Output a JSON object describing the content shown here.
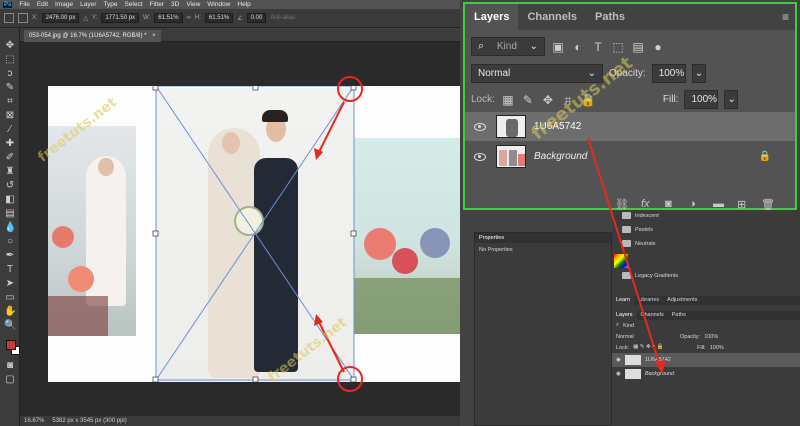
{
  "menubar": {
    "app_badge": "Ps",
    "items": [
      "File",
      "Edit",
      "Image",
      "Layer",
      "Type",
      "Select",
      "Filter",
      "3D",
      "View",
      "Window",
      "Help"
    ]
  },
  "options": {
    "x_label": "X:",
    "x_value": "2476.00 px",
    "y_label": "Y:",
    "y_value": "1771.50 px",
    "w_label": "W:",
    "w_value": "61.51%",
    "h_label": "H:",
    "h_value": "61.51%",
    "angle_value": "0.00",
    "antialias_label": "Anti-alias"
  },
  "document": {
    "tab_title": "053-054.jpg @ 16.7% (1U6A5742, RGB/8) *",
    "zoom": "16.67%",
    "dimensions": "5382 px x 3545 px (300 ppi)"
  },
  "colors": {
    "foreground": "#c83a3a",
    "background": "#ffffff",
    "highlight_green": "#3fcc3f",
    "annotation_red": "#e8281e"
  },
  "layers_panel": {
    "tabs": [
      "Layers",
      "Channels",
      "Paths"
    ],
    "active_tab": "Layers",
    "kind_label": "Kind",
    "blend_mode": "Normal",
    "opacity_label": "Opacity:",
    "opacity_value": "100%",
    "lock_label": "Lock:",
    "fill_label": "Fill:",
    "fill_value": "100%",
    "layers": [
      {
        "name": "1U6A5742",
        "selected": true
      },
      {
        "name": "Background",
        "selected": false,
        "locked": true
      }
    ]
  },
  "gradients": {
    "items": [
      "Iridescent",
      "Pastels",
      "Neutrals"
    ],
    "legacy": "Legacy Gradients"
  },
  "properties": {
    "title": "Properties",
    "content": "No Properties"
  },
  "mini_panel": {
    "tabs": [
      "Learn",
      "Libraries",
      "Adjustments"
    ],
    "layer_tabs": [
      "Layers",
      "Channels",
      "Paths"
    ],
    "kind_label": "Kind",
    "blend_mode": "Normal",
    "opacity_label": "Opacity:",
    "opacity_value": "100%",
    "lock_label": "Lock:",
    "fill_label": "Fill:",
    "fill_value": "100%",
    "layers": [
      "1U6A5742",
      "Background"
    ]
  },
  "watermark": "freetuts.net"
}
